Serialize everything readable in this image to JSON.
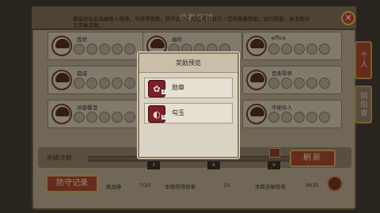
{
  "header": {
    "title": "结界突破",
    "notice": "寮成员在此突破他人结界，可获得奖励；防守成功，则会得到对方一定的勋章奖励；进行防御，并消耗对方突破次数。"
  },
  "side_tabs": [
    "个人",
    "阴阳寮"
  ],
  "cards": [
    {
      "name": "莲姬",
      "status": [
        "○",
        "○",
        "○",
        "○",
        "○"
      ]
    },
    {
      "name": "曲吟",
      "status": [
        "○",
        "○",
        "○",
        "○",
        "○"
      ]
    },
    {
      "name": "effice",
      "status": [
        "○",
        "○",
        "○",
        "○",
        "○"
      ]
    },
    {
      "name": "孤城",
      "status": [
        "○",
        "○",
        "○",
        "○",
        "○"
      ]
    },
    {
      "name": "",
      "status": [
        "○",
        "○",
        "○",
        "○",
        "○"
      ]
    },
    {
      "name": "百条琴师",
      "status": [
        "○",
        "○",
        "○",
        "○",
        "○"
      ]
    },
    {
      "name": "冰璇樱泪",
      "status": [
        "○",
        "○",
        "○",
        "○",
        "○"
      ]
    },
    {
      "name": "",
      "status": [
        "○",
        "○",
        "○",
        "○",
        "○"
      ]
    },
    {
      "name": "不绝伶人",
      "status": [
        "○",
        "○",
        "○",
        "○",
        "○"
      ]
    }
  ],
  "progress": {
    "label": "突破次数",
    "markers": [
      "3",
      "6",
      "9"
    ]
  },
  "buttons": {
    "refresh": "刷新",
    "record": "防守记录",
    "close": "✕"
  },
  "stats": {
    "tickets_label": "挑战券",
    "tickets_value": "7/20",
    "medals_label": "本周获得勋章",
    "medals_value": "10",
    "breaks_label": "本周击破排名",
    "breaks_value": "9635"
  },
  "modal": {
    "title": "奖励预览",
    "rewards": [
      {
        "name": "勋章",
        "count": "2",
        "icon": "medal-icon"
      },
      {
        "name": "勾玉",
        "count": "5",
        "icon": "jade-icon"
      }
    ]
  },
  "colors": {
    "accent_red": "#a5402a",
    "gold_border": "#d9ab5b",
    "panel": "#b9ab93"
  }
}
